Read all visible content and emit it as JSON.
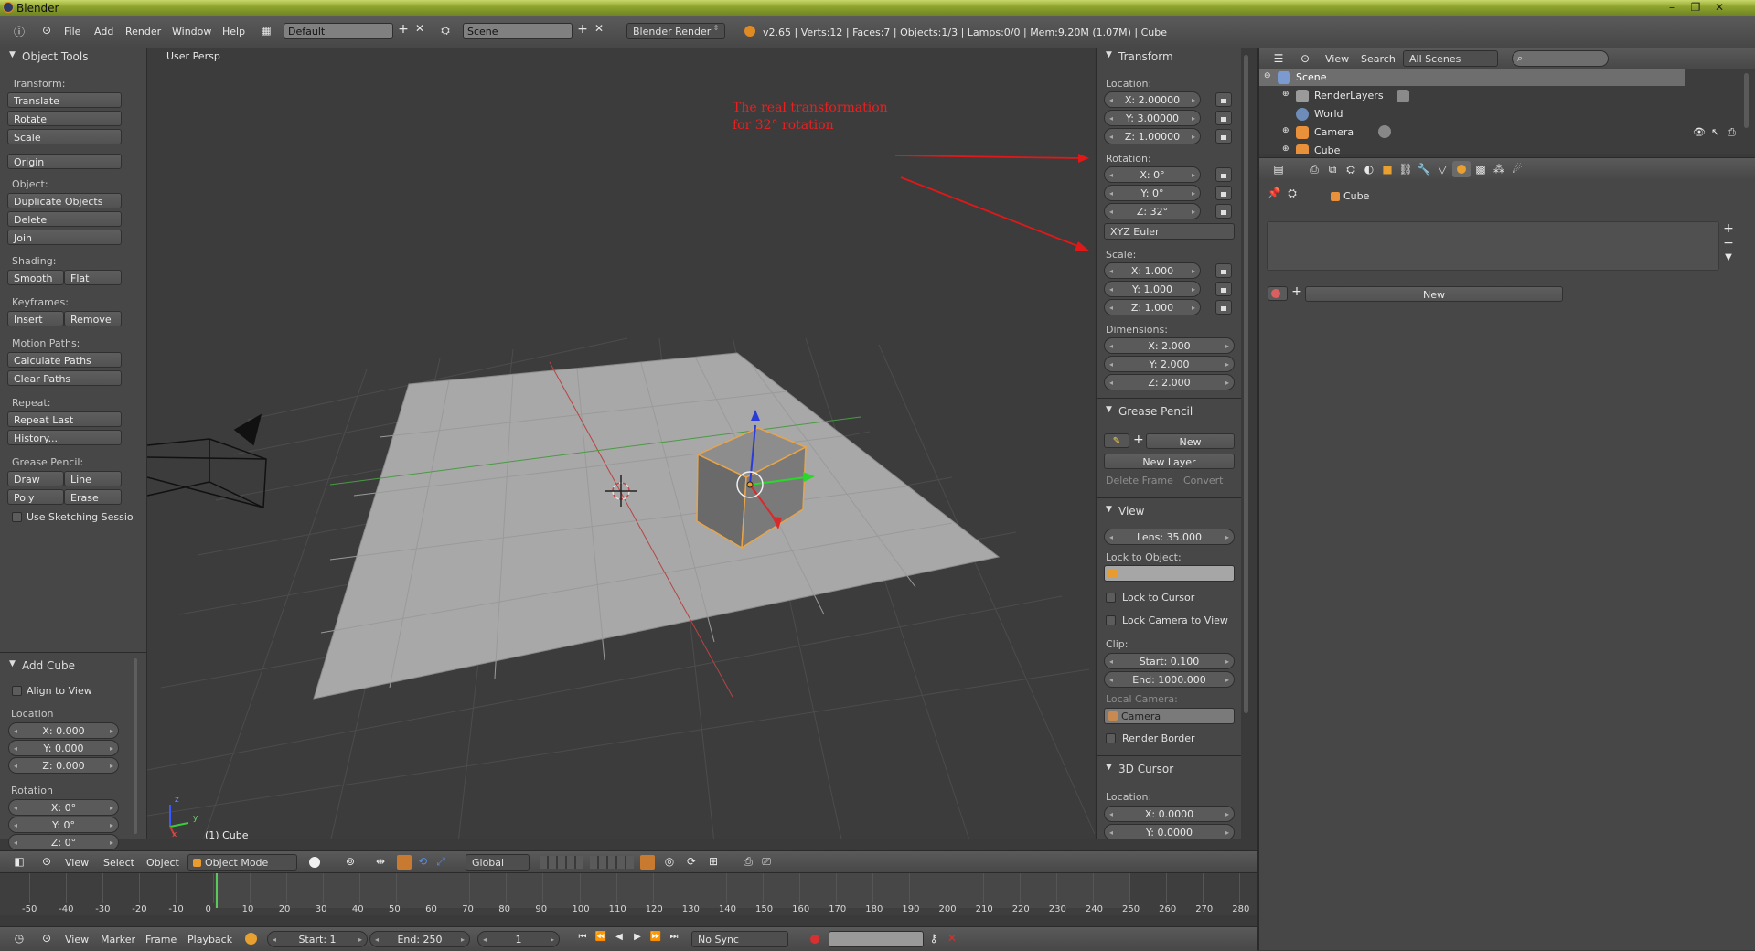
{
  "window": {
    "title": "Blender"
  },
  "info_header": {
    "menus": [
      "File",
      "Add",
      "Render",
      "Window",
      "Help"
    ],
    "screen_layout": "Default",
    "scene": "Scene",
    "render_engine": "Blender Render",
    "stats": "v2.65 | Verts:12 | Faces:7 | Objects:1/3 | Lamps:0/0 | Mem:9.20M (1.07M) | Cube"
  },
  "tool_shelf": {
    "title": "Object Tools",
    "transform_label": "Transform:",
    "translate": "Translate",
    "rotate": "Rotate",
    "scale": "Scale",
    "origin": "Origin",
    "object_label": "Object:",
    "duplicate": "Duplicate Objects",
    "delete": "Delete",
    "join": "Join",
    "shading_label": "Shading:",
    "smooth": "Smooth",
    "flat": "Flat",
    "keyframes_label": "Keyframes:",
    "insert": "Insert",
    "remove": "Remove",
    "motion_label": "Motion Paths:",
    "calc_paths": "Calculate Paths",
    "clear_paths": "Clear Paths",
    "repeat_label": "Repeat:",
    "repeat_last": "Repeat Last",
    "history": "History...",
    "grease_label": "Grease Pencil:",
    "draw": "Draw",
    "line": "Line",
    "poly": "Poly",
    "erase": "Erase",
    "sketching": "Use Sketching Sessio"
  },
  "add_cube": {
    "title": "Add Cube",
    "align": "Align to View",
    "location_label": "Location",
    "loc_x": "X: 0.000",
    "loc_y": "Y: 0.000",
    "loc_z": "Z: 0.000",
    "rotation_label": "Rotation",
    "rot_x": "X: 0°",
    "rot_y": "Y: 0°",
    "rot_z": "Z: 0°"
  },
  "viewport": {
    "view_name": "User Persp",
    "object_label": "(1) Cube",
    "annotation_line1": "The real transformation",
    "annotation_line2": "for 32° rotation",
    "axis_x": "x",
    "axis_y": "y",
    "axis_z": "z"
  },
  "n_panel": {
    "transform_title": "Transform",
    "location_label": "Location:",
    "loc_x": "X: 2.00000",
    "loc_y": "Y: 3.00000",
    "loc_z": "Z: 1.00000",
    "rotation_label": "Rotation:",
    "rot_x": "X: 0°",
    "rot_y": "Y: 0°",
    "rot_z": "Z: 32°",
    "rot_mode": "XYZ Euler",
    "scale_label": "Scale:",
    "scale_x": "X: 1.000",
    "scale_y": "Y: 1.000",
    "scale_z": "Z: 1.000",
    "dimensions_label": "Dimensions:",
    "dim_x": "X: 2.000",
    "dim_y": "Y: 2.000",
    "dim_z": "Z: 2.000",
    "grease_title": "Grease Pencil",
    "gp_new": "New",
    "gp_new_layer": "New Layer",
    "gp_delete_frame": "Delete Frame",
    "gp_convert": "Convert",
    "view_title": "View",
    "lens": "Lens: 35.000",
    "lock_object_label": "Lock to Object:",
    "lock_cursor": "Lock to Cursor",
    "lock_camera": "Lock Camera to View",
    "clip_label": "Clip:",
    "clip_start": "Start: 0.100",
    "clip_end": "End: 1000.000",
    "local_camera_label": "Local Camera:",
    "local_camera": "Camera",
    "render_border": "Render Border",
    "cursor_title": "3D Cursor",
    "cursor_location_label": "Location:",
    "cursor_x": "X: 0.0000",
    "cursor_y": "Y: 0.0000"
  },
  "view3d_header": {
    "view": "View",
    "select": "Select",
    "object": "Object",
    "mode": "Object Mode",
    "orientation": "Global"
  },
  "timeline": {
    "ticks": [
      "-50",
      "-40",
      "-30",
      "-20",
      "-10",
      "0",
      "10",
      "20",
      "30",
      "40",
      "50",
      "60",
      "70",
      "80",
      "90",
      "100",
      "110",
      "120",
      "130",
      "140",
      "150",
      "160",
      "170",
      "180",
      "190",
      "200",
      "210",
      "220",
      "230",
      "240",
      "250",
      "260",
      "270",
      "280"
    ],
    "view": "View",
    "marker": "Marker",
    "frame": "Frame",
    "playback": "Playback",
    "start": "Start: 1",
    "end": "End: 250",
    "current": "1",
    "sync": "No Sync"
  },
  "outliner": {
    "view": "View",
    "search": "Search",
    "filter": "All Scenes",
    "items": [
      "Scene",
      "RenderLayers",
      "World",
      "Camera",
      "Cube"
    ]
  },
  "properties": {
    "object_name": "Cube",
    "new_button": "New"
  }
}
